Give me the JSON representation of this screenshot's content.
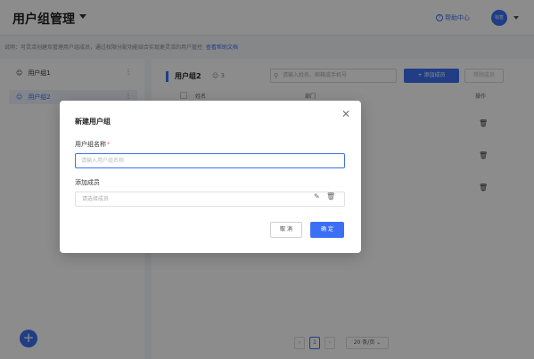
{
  "header": {
    "title": "用户组管理",
    "help": "帮助中心",
    "avatar": "标签"
  },
  "description": {
    "text": "说明：可灵活创建及管理用户组成员，通过权限分配功能结合实现更灵活的用户管控",
    "link": "查看帮助文档"
  },
  "sidebar": {
    "items": [
      {
        "label": "用户组1"
      },
      {
        "label": "用户组2"
      }
    ]
  },
  "main": {
    "group_name": "用户组2",
    "member_count": "3",
    "search_placeholder": "请输入姓名、邮箱或手机号",
    "add_member": "+ 添加成员",
    "remove_member": "移除成员",
    "columns": {
      "name": "姓名",
      "dept": "部门",
      "ops": "操作"
    },
    "pager": {
      "page": "1",
      "size": "20 条/页"
    }
  },
  "modal": {
    "title": "新建用户组",
    "name_label": "用户组名称",
    "name_required": "*",
    "name_placeholder": "请输入用户组名称",
    "name_value": "",
    "member_label": "添加成员",
    "member_placeholder": "请选择成员",
    "cancel": "取 消",
    "ok": "确 定"
  },
  "colors": {
    "accent": "#3b6ff5"
  },
  "icons": [
    "chevron-down-icon",
    "help-circle-icon",
    "user-group-icon",
    "more-icon",
    "search-icon",
    "trash-icon",
    "edit-icon",
    "close-icon",
    "plus-icon"
  ]
}
